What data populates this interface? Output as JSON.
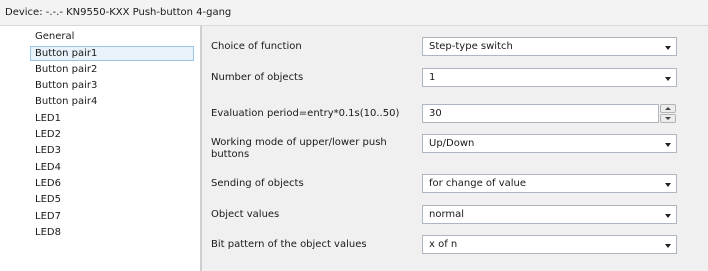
{
  "window": {
    "title": "Device: -.-.- KN9550-KXX Push-button 4-gang"
  },
  "sidebar": {
    "items": [
      {
        "label": "General"
      },
      {
        "label": "Button pair1",
        "selected": true
      },
      {
        "label": "Button pair2"
      },
      {
        "label": "Button pair3"
      },
      {
        "label": "Button pair4"
      },
      {
        "label": "LED1"
      },
      {
        "label": "LED2"
      },
      {
        "label": "LED3"
      },
      {
        "label": "LED4"
      },
      {
        "label": "LED6"
      },
      {
        "label": "LED5"
      },
      {
        "label": "LED7"
      },
      {
        "label": "LED8"
      }
    ]
  },
  "params": [
    {
      "label": "Choice of function",
      "value": "Step-type switch",
      "control": "dropdown"
    },
    {
      "label": "Number of objects",
      "value": "1",
      "control": "dropdown"
    },
    {
      "label": "Evaluation period=entry*0.1s(10..50)",
      "value": "30",
      "control": "spin"
    },
    {
      "label": "Working mode of upper/lower push buttons",
      "value": "Up/Down",
      "control": "dropdown"
    },
    {
      "label": "Sending of objects",
      "value": "for change of value",
      "control": "dropdown"
    },
    {
      "label": "Object values",
      "value": "normal",
      "control": "dropdown"
    },
    {
      "label": "Bit pattern of the object values",
      "value": "x of n",
      "control": "dropdown"
    }
  ],
  "icons": {
    "dropdown_arrow": "chevron-down-icon",
    "spin_up": "spin-up-icon",
    "spin_down": "spin-down-icon"
  },
  "colors": {
    "panel_bg": "#f0f0f0",
    "selection_border": "#9cc3e8",
    "selection_bg": "#e9f2fb"
  }
}
